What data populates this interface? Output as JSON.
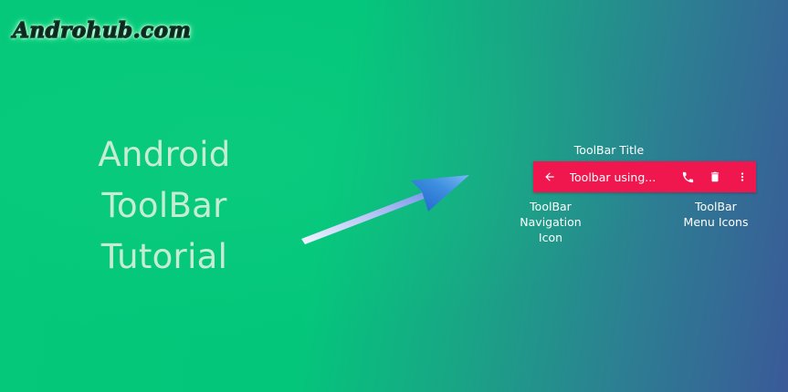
{
  "logo": {
    "text": "Androhub.com"
  },
  "heading": {
    "line1": "Android",
    "line2": "ToolBar",
    "line3": "Tutorial"
  },
  "annotations": {
    "title": "ToolBar Title",
    "nav_line1": "ToolBar",
    "nav_line2": "Navigation",
    "nav_line3": "Icon",
    "menu_line1": "ToolBar",
    "menu_line2": "Menu Icons"
  },
  "toolbar": {
    "navigation_icon": "arrow-back-icon",
    "title": "Toolbar using...",
    "menu_icons": [
      "phone-icon",
      "delete-icon",
      "more-vert-icon"
    ],
    "background_color": "#f0174f"
  },
  "colors": {
    "background_start": "#05c87a",
    "background_end": "#3a5a98",
    "heading_text": "#c6ecd4",
    "arrow": "#3f8fe0"
  }
}
